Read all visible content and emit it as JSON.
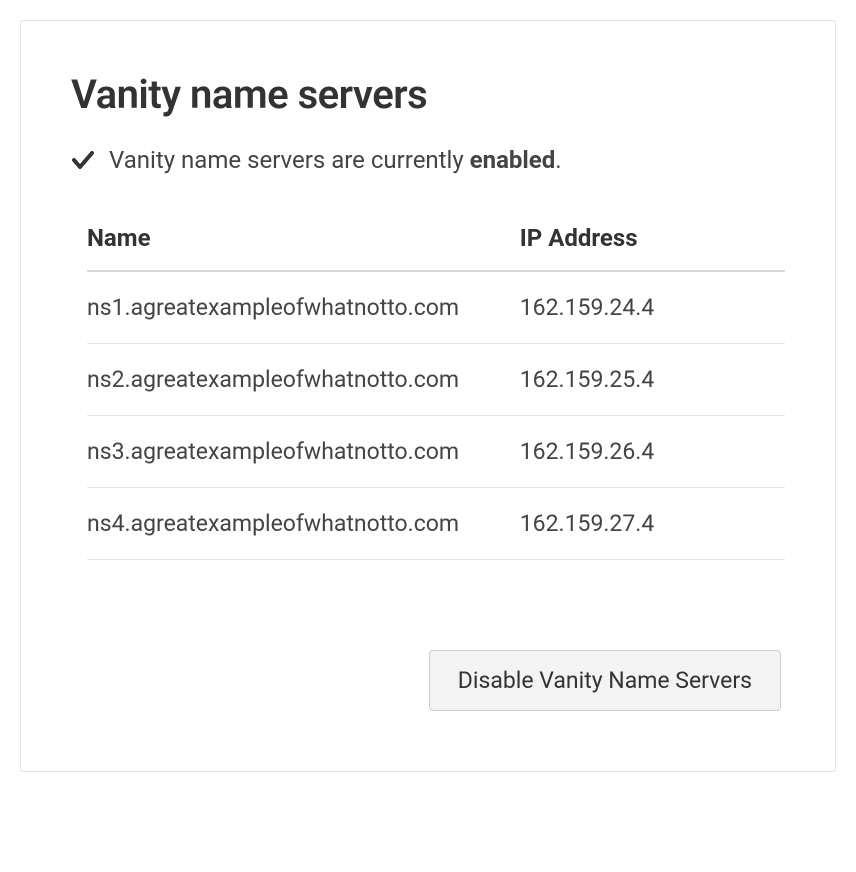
{
  "title": "Vanity name servers",
  "status": {
    "prefix": "Vanity name servers are currently ",
    "state": "enabled",
    "suffix": "."
  },
  "table": {
    "headers": {
      "name": "Name",
      "ip": "IP Address"
    },
    "rows": [
      {
        "name": "ns1.agreatexampleofwhatnotto.com",
        "ip": "162.159.24.4"
      },
      {
        "name": "ns2.agreatexampleofwhatnotto.com",
        "ip": "162.159.25.4"
      },
      {
        "name": "ns3.agreatexampleofwhatnotto.com",
        "ip": "162.159.26.4"
      },
      {
        "name": "ns4.agreatexampleofwhatnotto.com",
        "ip": "162.159.27.4"
      }
    ]
  },
  "button": {
    "disable_label": "Disable Vanity Name Servers"
  }
}
